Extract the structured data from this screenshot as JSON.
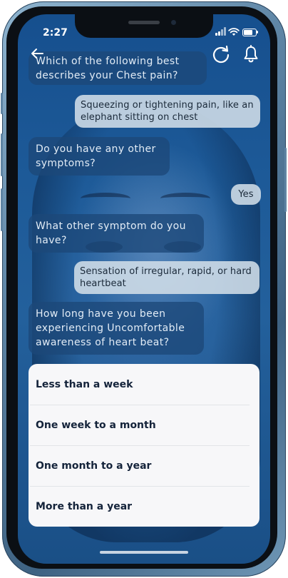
{
  "status_bar": {
    "time": "2:27"
  },
  "header": {
    "back_icon": "arrow-left-icon",
    "refresh_icon": "refresh-icon",
    "bell_icon": "bell-icon"
  },
  "chat": [
    {
      "from": "bot",
      "text": "Which of the following best describes your Chest pain?"
    },
    {
      "from": "user",
      "text": "Squeezing or tightening pain, like an elephant sitting on chest"
    },
    {
      "from": "bot",
      "text": "Do you have any other symptoms?"
    },
    {
      "from": "user",
      "text": "Yes"
    },
    {
      "from": "bot",
      "text": "What other symptom do you have?"
    },
    {
      "from": "user",
      "text": "Sensation of irregular, rapid, or hard heartbeat"
    },
    {
      "from": "bot",
      "text": "How long have you been experiencing Uncomfortable awareness of heart beat?"
    }
  ],
  "options": [
    {
      "label": "Less than a week"
    },
    {
      "label": "One week to a month"
    },
    {
      "label": "One month to a year"
    },
    {
      "label": "More than a year"
    }
  ],
  "colors": {
    "bot_bubble": "#1c4878",
    "user_bubble": "#d2dee8",
    "option_text": "#14233a"
  }
}
